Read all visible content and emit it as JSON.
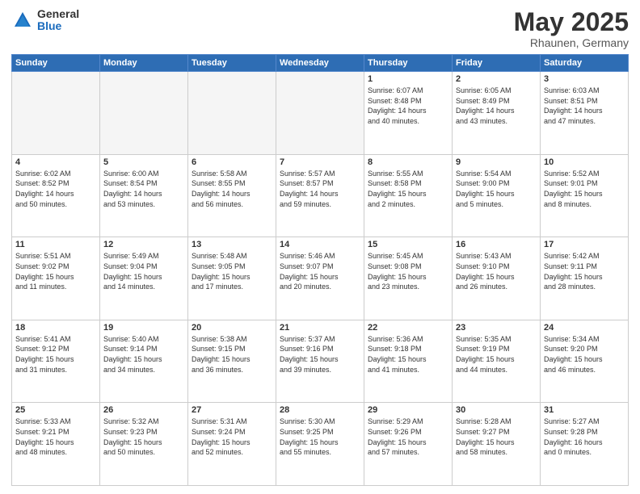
{
  "header": {
    "logo_general": "General",
    "logo_blue": "Blue",
    "month": "May 2025",
    "location": "Rhaunen, Germany"
  },
  "days_of_week": [
    "Sunday",
    "Monday",
    "Tuesday",
    "Wednesday",
    "Thursday",
    "Friday",
    "Saturday"
  ],
  "weeks": [
    [
      {
        "num": "",
        "info": "",
        "empty": true
      },
      {
        "num": "",
        "info": "",
        "empty": true
      },
      {
        "num": "",
        "info": "",
        "empty": true
      },
      {
        "num": "",
        "info": "",
        "empty": true
      },
      {
        "num": "1",
        "info": "Sunrise: 6:07 AM\nSunset: 8:48 PM\nDaylight: 14 hours\nand 40 minutes."
      },
      {
        "num": "2",
        "info": "Sunrise: 6:05 AM\nSunset: 8:49 PM\nDaylight: 14 hours\nand 43 minutes."
      },
      {
        "num": "3",
        "info": "Sunrise: 6:03 AM\nSunset: 8:51 PM\nDaylight: 14 hours\nand 47 minutes."
      }
    ],
    [
      {
        "num": "4",
        "info": "Sunrise: 6:02 AM\nSunset: 8:52 PM\nDaylight: 14 hours\nand 50 minutes."
      },
      {
        "num": "5",
        "info": "Sunrise: 6:00 AM\nSunset: 8:54 PM\nDaylight: 14 hours\nand 53 minutes."
      },
      {
        "num": "6",
        "info": "Sunrise: 5:58 AM\nSunset: 8:55 PM\nDaylight: 14 hours\nand 56 minutes."
      },
      {
        "num": "7",
        "info": "Sunrise: 5:57 AM\nSunset: 8:57 PM\nDaylight: 14 hours\nand 59 minutes."
      },
      {
        "num": "8",
        "info": "Sunrise: 5:55 AM\nSunset: 8:58 PM\nDaylight: 15 hours\nand 2 minutes."
      },
      {
        "num": "9",
        "info": "Sunrise: 5:54 AM\nSunset: 9:00 PM\nDaylight: 15 hours\nand 5 minutes."
      },
      {
        "num": "10",
        "info": "Sunrise: 5:52 AM\nSunset: 9:01 PM\nDaylight: 15 hours\nand 8 minutes."
      }
    ],
    [
      {
        "num": "11",
        "info": "Sunrise: 5:51 AM\nSunset: 9:02 PM\nDaylight: 15 hours\nand 11 minutes."
      },
      {
        "num": "12",
        "info": "Sunrise: 5:49 AM\nSunset: 9:04 PM\nDaylight: 15 hours\nand 14 minutes."
      },
      {
        "num": "13",
        "info": "Sunrise: 5:48 AM\nSunset: 9:05 PM\nDaylight: 15 hours\nand 17 minutes."
      },
      {
        "num": "14",
        "info": "Sunrise: 5:46 AM\nSunset: 9:07 PM\nDaylight: 15 hours\nand 20 minutes."
      },
      {
        "num": "15",
        "info": "Sunrise: 5:45 AM\nSunset: 9:08 PM\nDaylight: 15 hours\nand 23 minutes."
      },
      {
        "num": "16",
        "info": "Sunrise: 5:43 AM\nSunset: 9:10 PM\nDaylight: 15 hours\nand 26 minutes."
      },
      {
        "num": "17",
        "info": "Sunrise: 5:42 AM\nSunset: 9:11 PM\nDaylight: 15 hours\nand 28 minutes."
      }
    ],
    [
      {
        "num": "18",
        "info": "Sunrise: 5:41 AM\nSunset: 9:12 PM\nDaylight: 15 hours\nand 31 minutes."
      },
      {
        "num": "19",
        "info": "Sunrise: 5:40 AM\nSunset: 9:14 PM\nDaylight: 15 hours\nand 34 minutes."
      },
      {
        "num": "20",
        "info": "Sunrise: 5:38 AM\nSunset: 9:15 PM\nDaylight: 15 hours\nand 36 minutes."
      },
      {
        "num": "21",
        "info": "Sunrise: 5:37 AM\nSunset: 9:16 PM\nDaylight: 15 hours\nand 39 minutes."
      },
      {
        "num": "22",
        "info": "Sunrise: 5:36 AM\nSunset: 9:18 PM\nDaylight: 15 hours\nand 41 minutes."
      },
      {
        "num": "23",
        "info": "Sunrise: 5:35 AM\nSunset: 9:19 PM\nDaylight: 15 hours\nand 44 minutes."
      },
      {
        "num": "24",
        "info": "Sunrise: 5:34 AM\nSunset: 9:20 PM\nDaylight: 15 hours\nand 46 minutes."
      }
    ],
    [
      {
        "num": "25",
        "info": "Sunrise: 5:33 AM\nSunset: 9:21 PM\nDaylight: 15 hours\nand 48 minutes."
      },
      {
        "num": "26",
        "info": "Sunrise: 5:32 AM\nSunset: 9:23 PM\nDaylight: 15 hours\nand 50 minutes."
      },
      {
        "num": "27",
        "info": "Sunrise: 5:31 AM\nSunset: 9:24 PM\nDaylight: 15 hours\nand 52 minutes."
      },
      {
        "num": "28",
        "info": "Sunrise: 5:30 AM\nSunset: 9:25 PM\nDaylight: 15 hours\nand 55 minutes."
      },
      {
        "num": "29",
        "info": "Sunrise: 5:29 AM\nSunset: 9:26 PM\nDaylight: 15 hours\nand 57 minutes."
      },
      {
        "num": "30",
        "info": "Sunrise: 5:28 AM\nSunset: 9:27 PM\nDaylight: 15 hours\nand 58 minutes."
      },
      {
        "num": "31",
        "info": "Sunrise: 5:27 AM\nSunset: 9:28 PM\nDaylight: 16 hours\nand 0 minutes."
      }
    ]
  ]
}
